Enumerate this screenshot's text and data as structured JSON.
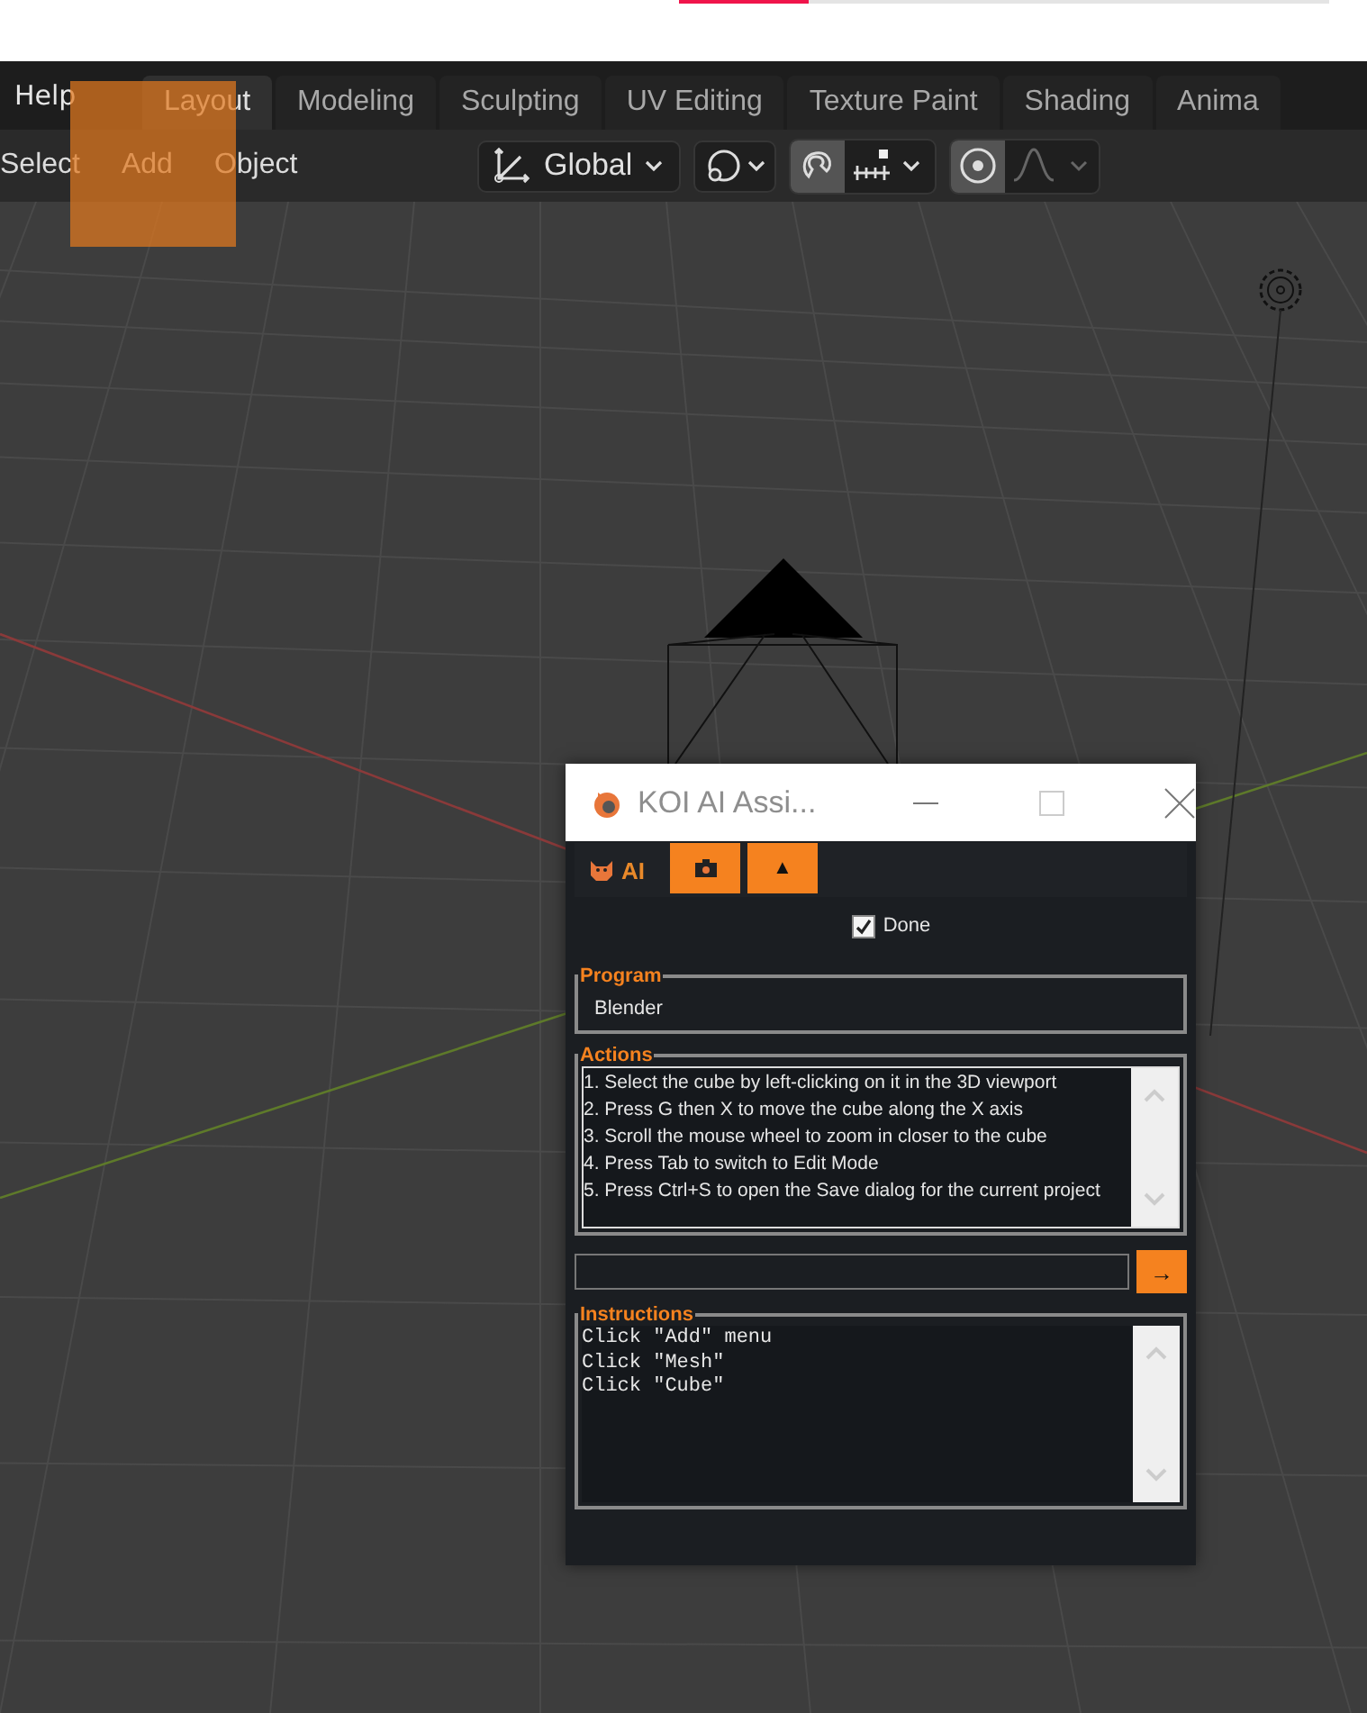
{
  "loading_bar": {
    "level": 0.2
  },
  "topbar": {
    "menu": "Help",
    "tabs": [
      {
        "label": "Layout",
        "selected": true
      },
      {
        "label": "Modeling",
        "selected": false
      },
      {
        "label": "Sculpting",
        "selected": false
      },
      {
        "label": "UV Editing",
        "selected": false
      },
      {
        "label": "Texture Paint",
        "selected": false
      },
      {
        "label": "Shading",
        "selected": false
      },
      {
        "label": "Anima",
        "selected": false
      }
    ]
  },
  "toolbar": {
    "menus": [
      "Select",
      "Add",
      "Object"
    ],
    "orientation": "Global",
    "snap_on": true,
    "proportional_on": true
  },
  "dialog": {
    "title": "KOI AI Assi...",
    "tab": "AI",
    "up_button": "▲",
    "done": {
      "label": "Done",
      "checked": true
    },
    "program": {
      "legend": "Program",
      "value": "Blender"
    },
    "actions": {
      "legend": "Actions",
      "items": [
        "1. Select the cube by left-clicking on it in the 3D viewport",
        "2. Press G then X to move the cube along the X axis",
        "3. Scroll the mouse wheel to zoom in closer to the cube",
        "4. Press Tab to switch to Edit Mode",
        "5. Press Ctrl+S to open the Save dialog for the current project"
      ]
    },
    "send_button": "→",
    "instructions": {
      "legend": "Instructions",
      "lines": [
        "Click \"Add\" menu",
        "Click \"Mesh\"",
        "Click \"Cube\""
      ]
    }
  }
}
